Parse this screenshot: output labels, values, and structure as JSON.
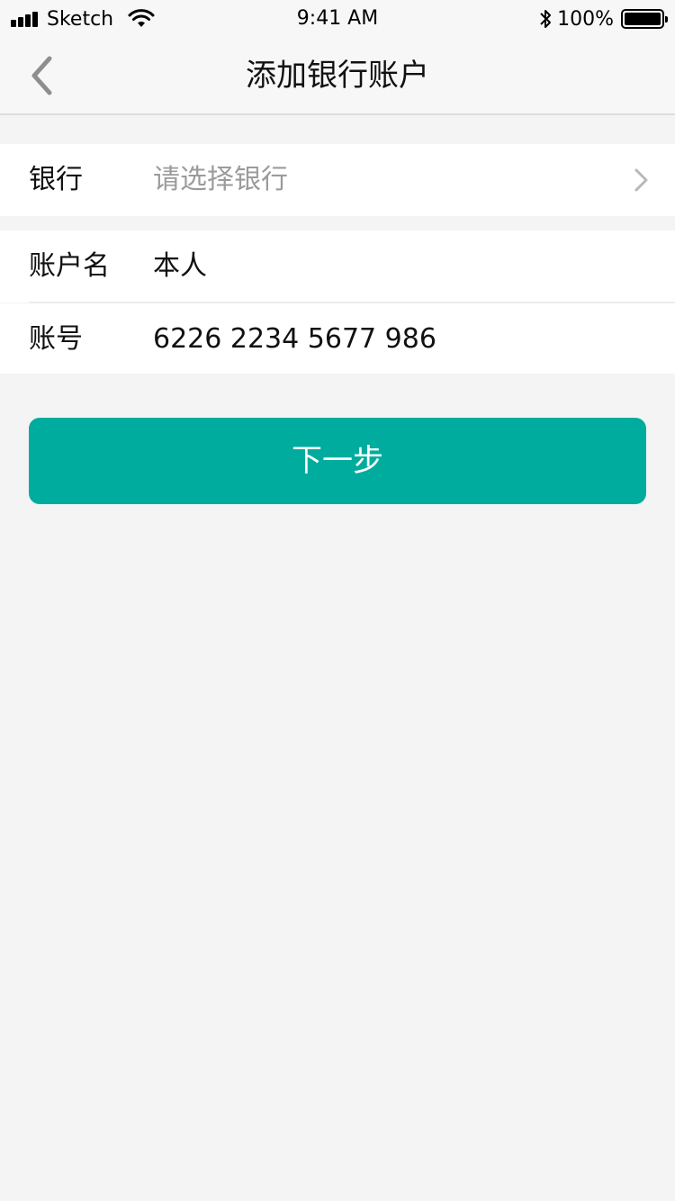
{
  "status_bar": {
    "carrier": "Sketch",
    "time": "9:41 AM",
    "battery": "100%",
    "icons": [
      "signal-icon",
      "wifi-icon",
      "bluetooth-icon",
      "battery-icon"
    ]
  },
  "nav": {
    "title": "添加银行账户",
    "back_icon": "chevron-left-icon"
  },
  "form": {
    "bank": {
      "label": "银行",
      "placeholder": "请选择银行",
      "icon": "chevron-right-icon"
    },
    "account_name": {
      "label": "账户名",
      "value": "本人"
    },
    "account_number": {
      "label": "账号",
      "value": "6226 2234 5677 986"
    }
  },
  "actions": {
    "next_label": "下一步"
  },
  "colors": {
    "accent": "#00ac9e",
    "background": "#f4f4f4",
    "placeholder": "#9b9b9b"
  }
}
